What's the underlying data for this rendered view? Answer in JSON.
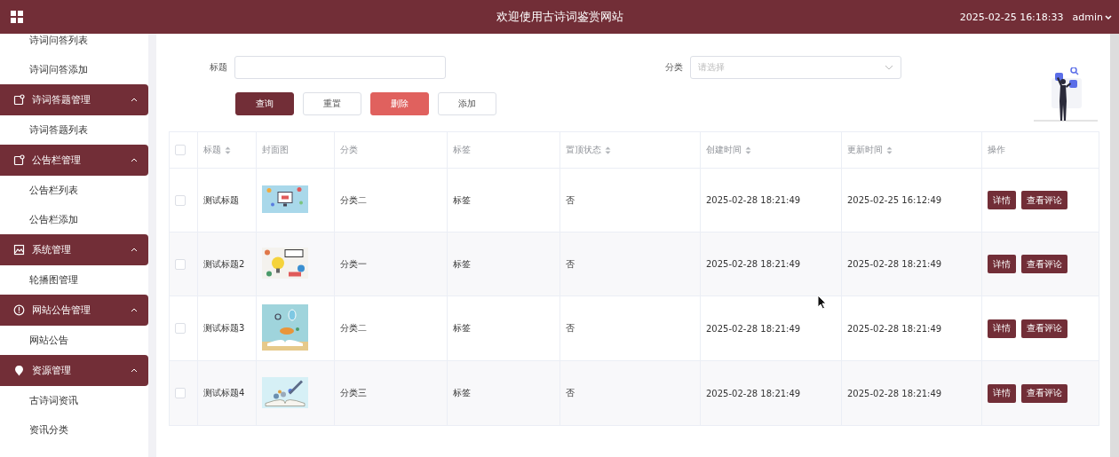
{
  "header": {
    "title": "欢迎使用古诗词鉴赏网站",
    "datetime": "2025-02-25 16:18:33",
    "user": "admin"
  },
  "sidebar": {
    "items": [
      {
        "kind": "link",
        "label": "诗词问答列表"
      },
      {
        "kind": "link",
        "label": "诗词问答添加"
      },
      {
        "kind": "group",
        "label": "诗词答题管理",
        "expanded": true
      },
      {
        "kind": "link",
        "label": "诗词答题列表"
      },
      {
        "kind": "group",
        "label": "公告栏管理",
        "expanded": true
      },
      {
        "kind": "link",
        "label": "公告栏列表"
      },
      {
        "kind": "link",
        "label": "公告栏添加"
      },
      {
        "kind": "group",
        "label": "系统管理",
        "expanded": true
      },
      {
        "kind": "link",
        "label": "轮播图管理"
      },
      {
        "kind": "group",
        "label": "网站公告管理",
        "expanded": true
      },
      {
        "kind": "link",
        "label": "网站公告"
      },
      {
        "kind": "group",
        "label": "资源管理",
        "expanded": true
      },
      {
        "kind": "link",
        "label": "古诗词资讯"
      },
      {
        "kind": "link",
        "label": "资讯分类"
      }
    ]
  },
  "search": {
    "fields": [
      {
        "kind": "text",
        "label": "标题"
      },
      {
        "kind": "select",
        "label": "分类",
        "placeholder": "请选择"
      }
    ],
    "buttons": [
      {
        "kind": "primary",
        "label": "查询"
      },
      {
        "kind": "plain",
        "label": "重置"
      },
      {
        "kind": "danger",
        "label": "删除"
      },
      {
        "kind": "plain",
        "label": "添加"
      }
    ]
  },
  "table": {
    "select_all": {
      "checked": false
    },
    "columns": [
      {
        "label": "标题",
        "sortable": true
      },
      {
        "label": "封面图",
        "sortable": false
      },
      {
        "label": "分类",
        "sortable": false
      },
      {
        "label": "标签",
        "sortable": false
      },
      {
        "label": "置顶状态",
        "sortable": true
      },
      {
        "label": "创建时间",
        "sortable": true
      },
      {
        "label": "更新时间",
        "sortable": true
      },
      {
        "label": "操作",
        "sortable": false
      }
    ],
    "rows": [
      {
        "checked": false,
        "title": "测试标题",
        "category": "分类二",
        "tag": "标签",
        "pinned": "否",
        "created": "2025-02-28 18:21:49",
        "updated": "2025-02-25 16:12:49",
        "actions": [
          "详情",
          "查看评论"
        ]
      },
      {
        "checked": false,
        "title": "测试标题2",
        "category": "分类一",
        "tag": "标签",
        "pinned": "否",
        "created": "2025-02-28 18:21:49",
        "updated": "2025-02-28 18:21:49",
        "actions": [
          "详情",
          "查看评论"
        ]
      },
      {
        "checked": false,
        "title": "测试标题3",
        "category": "分类二",
        "tag": "标签",
        "pinned": "否",
        "created": "2025-02-28 18:21:49",
        "updated": "2025-02-28 18:21:49",
        "actions": [
          "详情",
          "查看评论"
        ]
      },
      {
        "checked": false,
        "title": "测试标题4",
        "category": "分类三",
        "tag": "标签",
        "pinned": "否",
        "created": "2025-02-28 18:21:49",
        "updated": "2025-02-28 18:21:49",
        "actions": [
          "详情",
          "查看评论"
        ]
      }
    ]
  }
}
